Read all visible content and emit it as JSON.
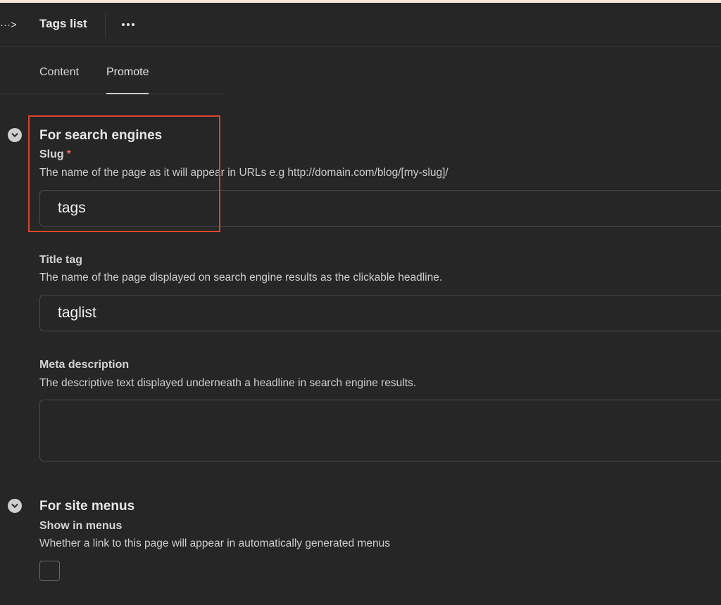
{
  "header": {
    "toggle_label": "···>",
    "title": "Tags list"
  },
  "tabs": [
    {
      "label": "Content"
    },
    {
      "label": "Promote"
    }
  ],
  "sections": {
    "search_engines": {
      "heading": "For search engines",
      "slug": {
        "label": "Slug",
        "required_marker": "*",
        "help": "The name of the page as it will appear in URLs e.g http://domain.com/blog/[my-slug]/",
        "value": "tags"
      },
      "title_tag": {
        "label": "Title tag",
        "help": "The name of the page displayed on search engine results as the clickable headline.",
        "value": "taglist"
      },
      "meta_description": {
        "label": "Meta description",
        "help": "The descriptive text displayed underneath a headline in search engine results.",
        "value": ""
      }
    },
    "site_menus": {
      "heading": "For site menus",
      "show_in_menus": {
        "label": "Show in menus",
        "help": "Whether a link to this page will appear in automatically generated menus",
        "checked": false
      }
    }
  },
  "colors": {
    "background": "#262626",
    "highlight": "#d9452f",
    "required": "#e0655b"
  }
}
